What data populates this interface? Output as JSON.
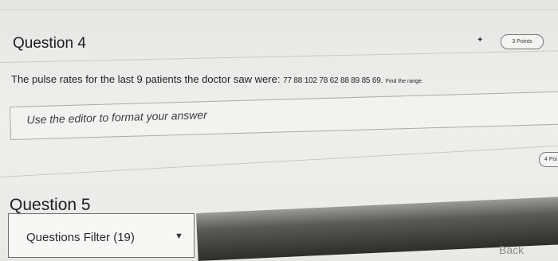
{
  "question4": {
    "title": "Question 4",
    "points": "3 Points",
    "text_main": "The pulse rates for the last 9 patients the doctor saw were:",
    "text_data": "77 88 102 78 62 88 89 85 69.",
    "text_find": "Find the range.",
    "editor_placeholder": "Use the editor to format your answer"
  },
  "question5": {
    "title": "Question 5",
    "points": "4 Poi"
  },
  "filter": {
    "label": "Questions Filter (19)"
  },
  "footer": {
    "back_label": "Back"
  }
}
